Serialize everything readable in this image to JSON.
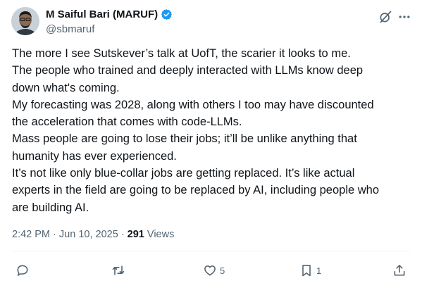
{
  "author": {
    "name": "M Saiful Bari (MARUF)",
    "handle": "@sbmaruf",
    "verified_color": "#1d9bf0"
  },
  "tweet": {
    "lines": [
      "The more I see Sutskever’s talk at UofT, the scarier it looks to me.",
      "The people who trained and deeply interacted with LLMs know deep",
      "down what's coming.",
      "My forecasting was 2028, along with others I too may have discounted",
      "the acceleration that comes with code-LLMs.",
      "Mass people are going to lose their jobs; it’ll be unlike anything that",
      "humanity has ever experienced.",
      "It’s not like only blue-collar jobs are getting replaced. It’s like actual",
      "experts in the field are going to be replaced by AI, including people who",
      "are building AI."
    ]
  },
  "meta": {
    "time": "2:42 PM",
    "date": "Jun 10, 2025",
    "separator": "·",
    "views_count": "291",
    "views_label": "Views"
  },
  "actions": {
    "reply_count": "",
    "retweet_count": "",
    "like_count": "5",
    "bookmark_count": "1"
  },
  "icons": {
    "grok": "grok-icon",
    "more": "more-icon",
    "reply": "reply-icon",
    "retweet": "retweet-icon",
    "like": "heart-icon",
    "bookmark": "bookmark-icon",
    "share": "share-icon"
  },
  "colors": {
    "text": "#0f1419",
    "secondary": "#536471",
    "accent": "#1d9bf0"
  }
}
